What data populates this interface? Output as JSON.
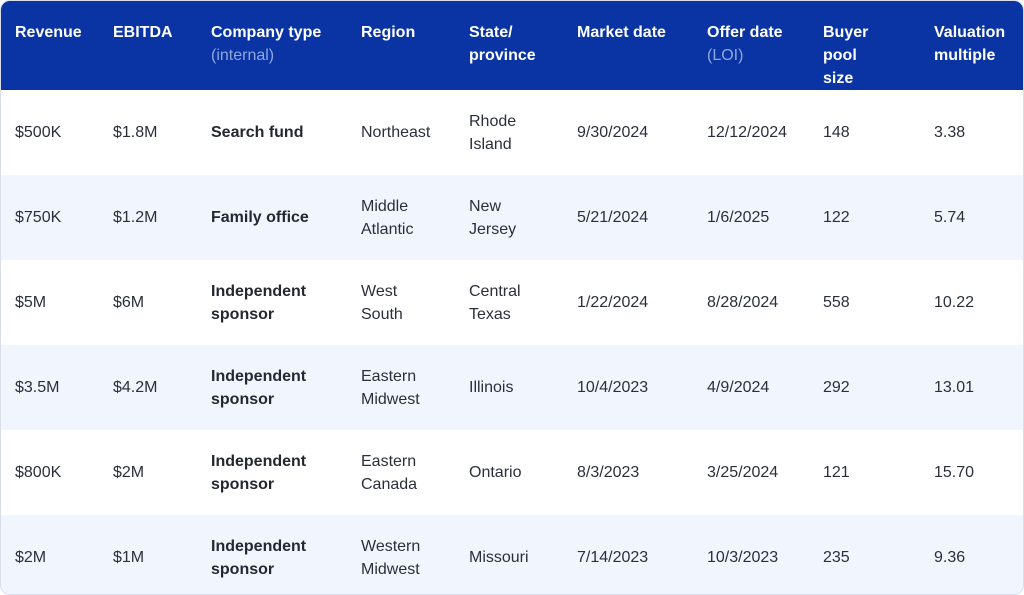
{
  "columns": [
    {
      "label": "Revenue",
      "sub": ""
    },
    {
      "label": "EBITDA",
      "sub": ""
    },
    {
      "label": "Company type",
      "sub": "(internal)"
    },
    {
      "label": "Region",
      "sub": ""
    },
    {
      "label": "State/ province",
      "sub": ""
    },
    {
      "label": "Market date",
      "sub": ""
    },
    {
      "label": "Offer date",
      "sub": "(LOI)"
    },
    {
      "label": "Buyer pool size",
      "sub": ""
    },
    {
      "label": "Valuation multiple",
      "sub": ""
    }
  ],
  "rows": [
    {
      "revenue": "$500K",
      "ebitda": "$1.8M",
      "company_type": "Search fund",
      "region": "Northeast",
      "state": "Rhode Island",
      "market_date": "9/30/2024",
      "offer_date": "12/12/2024",
      "buyer_pool": "148",
      "multiple": "3.38"
    },
    {
      "revenue": "$750K",
      "ebitda": "$1.2M",
      "company_type": "Family office",
      "region": "Middle Atlantic",
      "state": "New Jersey",
      "market_date": "5/21/2024",
      "offer_date": "1/6/2025",
      "buyer_pool": "122",
      "multiple": "5.74"
    },
    {
      "revenue": "$5M",
      "ebitda": "$6M",
      "company_type": "Independent sponsor",
      "region": "West South",
      "state": "Central Texas",
      "market_date": "1/22/2024",
      "offer_date": "8/28/2024",
      "buyer_pool": "558",
      "multiple": "10.22"
    },
    {
      "revenue": "$3.5M",
      "ebitda": "$4.2M",
      "company_type": "Independent sponsor",
      "region": "Eastern Midwest",
      "state": "Illinois",
      "market_date": "10/4/2023",
      "offer_date": "4/9/2024",
      "buyer_pool": "292",
      "multiple": "13.01"
    },
    {
      "revenue": "$800K",
      "ebitda": "$2M",
      "company_type": "Independent sponsor",
      "region": "Eastern Canada",
      "state": "Ontario",
      "market_date": "8/3/2023",
      "offer_date": "3/25/2024",
      "buyer_pool": "121",
      "multiple": "15.70"
    },
    {
      "revenue": "$2M",
      "ebitda": "$1M",
      "company_type": "Independent sponsor",
      "region": "Western Midwest",
      "state": "Missouri",
      "market_date": "7/14/2023",
      "offer_date": "10/3/2023",
      "buyer_pool": "235",
      "multiple": "9.36"
    }
  ],
  "colors": {
    "header_bg": "#0a34a3",
    "header_text": "#ffffff",
    "header_sub_text": "#8fa7dd",
    "row_alt_bg": "#f1f5fe",
    "body_text": "#2b2f3a"
  }
}
